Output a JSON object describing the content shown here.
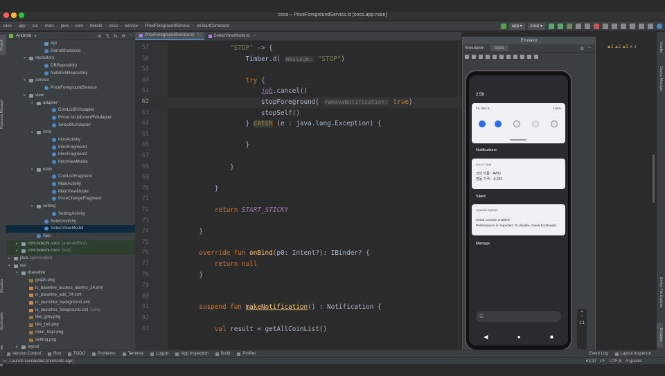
{
  "window": {
    "title": "coco – PriceForegroundService.kt [coco.app.main]"
  },
  "breadcrumbs": [
    "coco",
    "app",
    "src",
    "main",
    "java",
    "com",
    "bokchi",
    "coco",
    "service",
    "PriceForegroundService",
    "onStartCommand"
  ],
  "run_config": "app",
  "device": "coco",
  "project": {
    "view": "Android",
    "rows": [
      {
        "d": 5,
        "t": "f",
        "label": "Api"
      },
      {
        "d": 5,
        "t": "c",
        "label": "RetrofitInstance"
      },
      {
        "d": 3,
        "t": "d",
        "open": true,
        "label": "repository"
      },
      {
        "d": 5,
        "t": "c",
        "label": "DBRepository"
      },
      {
        "d": 5,
        "t": "c",
        "label": "NetWorkRepository"
      },
      {
        "d": 3,
        "t": "d",
        "open": true,
        "label": "service"
      },
      {
        "d": 5,
        "t": "c",
        "label": "PriceForegroundService"
      },
      {
        "d": 3,
        "t": "d",
        "open": true,
        "label": "view"
      },
      {
        "d": 4,
        "t": "d",
        "open": true,
        "label": "adapter"
      },
      {
        "d": 6,
        "t": "c",
        "label": "CoinListRVAdapter"
      },
      {
        "d": 6,
        "t": "c",
        "label": "PriceListUpDownRVAdapter"
      },
      {
        "d": 6,
        "t": "c",
        "label": "SelectRVAdapter"
      },
      {
        "d": 4,
        "t": "d",
        "open": true,
        "label": "intro"
      },
      {
        "d": 6,
        "t": "c",
        "label": "IntroActivity"
      },
      {
        "d": 6,
        "t": "c",
        "label": "IntroFragment1"
      },
      {
        "d": 6,
        "t": "c",
        "label": "IntroFragment2"
      },
      {
        "d": 6,
        "t": "c",
        "label": "IntroViewModel"
      },
      {
        "d": 4,
        "t": "d",
        "open": true,
        "label": "main"
      },
      {
        "d": 6,
        "t": "c",
        "label": "CoinListFragment"
      },
      {
        "d": 6,
        "t": "c",
        "label": "MainActivity"
      },
      {
        "d": 6,
        "t": "c",
        "label": "MainViewModel"
      },
      {
        "d": 6,
        "t": "c",
        "label": "PriceChangeFragment"
      },
      {
        "d": 4,
        "t": "d",
        "open": true,
        "label": "setting"
      },
      {
        "d": 6,
        "t": "c",
        "label": "SettingActivity"
      },
      {
        "d": 5,
        "t": "c",
        "label": "SelectActivity"
      },
      {
        "d": 5,
        "t": "c",
        "label": "SelectViewModel",
        "sel": true
      },
      {
        "d": 4,
        "t": "c",
        "label": "App"
      },
      {
        "d": 2,
        "t": "d",
        "closed": true,
        "label": "com.bokchi.coco",
        "suffix": "(androidTest)",
        "sel2": true
      },
      {
        "d": 2,
        "t": "d",
        "closed": true,
        "label": "com.bokchi.coco",
        "suffix": "(test)",
        "sel2": true
      },
      {
        "d": 1,
        "t": "d",
        "closed": true,
        "label": "java",
        "suffix": "(generated)"
      },
      {
        "d": 1,
        "t": "d",
        "open": true,
        "label": "res"
      },
      {
        "d": 2,
        "t": "d",
        "open": true,
        "label": "drawable"
      },
      {
        "d": 3,
        "t": "i",
        "label": "graph.png"
      },
      {
        "d": 3,
        "t": "x",
        "label": "ic_baseline_access_alarms_24.xml"
      },
      {
        "d": 3,
        "t": "x",
        "label": "ic_baseline_add_24.xml"
      },
      {
        "d": 3,
        "t": "x",
        "label": "ic_launcher_background.xml"
      },
      {
        "d": 3,
        "t": "x",
        "label": "ic_launcher_foreground.xml",
        "suffix": "(v24)"
      },
      {
        "d": 3,
        "t": "i",
        "label": "like_grey.png"
      },
      {
        "d": 3,
        "t": "i",
        "label": "like_red.png"
      },
      {
        "d": 3,
        "t": "i",
        "label": "main_logo.png"
      },
      {
        "d": 3,
        "t": "i",
        "label": "setting.png"
      },
      {
        "d": 2,
        "t": "d",
        "closed": true,
        "label": "layout"
      }
    ]
  },
  "tabs": [
    {
      "label": "PriceForegroundService.kt",
      "active": true
    },
    {
      "label": "SelectViewModel.kt",
      "active": false
    }
  ],
  "code_lines": [
    {
      "n": "57",
      "html": "            <span class='str'>\"STOP\"</span> -> {"
    },
    {
      "n": "58",
      "html": "                Timber.d( <span class='hint'>message:</span> <span class='str'>\"STOP\"</span>)"
    },
    {
      "n": "59",
      "html": ""
    },
    {
      "n": "60",
      "html": "                <span class='kw'>try</span> {"
    },
    {
      "n": "61",
      "html": "                    <span class='const under'>job</span>.cancel()"
    },
    {
      "n": "62",
      "html": "                    stopForeground( <span class='hint'>removeNotification:</span> <span class='kw'>true</span>)",
      "cur": true
    },
    {
      "n": "63",
      "html": "                    stopSelf()"
    },
    {
      "n": "64",
      "html": "                } <span class='kw hl'>catch</span> (e : java.lang.Exception) {"
    },
    {
      "n": "65",
      "html": ""
    },
    {
      "n": "66",
      "html": "                }"
    },
    {
      "n": "67",
      "html": ""
    },
    {
      "n": "68",
      "html": "            }"
    },
    {
      "n": "69",
      "html": ""
    },
    {
      "n": "70",
      "html": "        }"
    },
    {
      "n": "71",
      "html": ""
    },
    {
      "n": "72",
      "html": "        <span class='kw'>return</span> <span class='const'>START_STICKY</span>"
    },
    {
      "n": "73",
      "html": ""
    },
    {
      "n": "74",
      "html": "    }"
    },
    {
      "n": "75",
      "html": ""
    },
    {
      "n": "76",
      "html": "    <span class='kw'>override fun</span> <span class='fn'>onBind</span>(p0: Intent?): IBinder? {"
    },
    {
      "n": "77",
      "html": "        <span class='kw'>return null</span>"
    },
    {
      "n": "78",
      "html": "    }"
    },
    {
      "n": "79",
      "html": ""
    },
    {
      "n": "80",
      "html": ""
    },
    {
      "n": "81",
      "html": "    <span class='kw'>suspend fun</span> <span class='fn under'>makeNotification</span>() : Notification {"
    },
    {
      "n": "82",
      "html": ""
    },
    {
      "n": "83",
      "html": "        <span class='kw'>val</span> result = getAllCoinList()"
    }
  ],
  "emulator": {
    "title": "Emulator",
    "label": "Emulator:",
    "device": "coco",
    "time": "2:58",
    "date": "Fri, Dec 9",
    "battery": "100%",
    "notifications_header": "Notifications",
    "app_line": "coco • now",
    "coin_name": "코인 이름 : AWO",
    "price_change": "변동 가격 : -0.092",
    "silent_header": "Silent",
    "sys_app": "Android System",
    "serial_title": "Serial console enabled",
    "serial_body": "Performance is impacted. To disable, check bootloader.",
    "manage": "Manage",
    "zoom": "1:1"
  },
  "warnings": {
    "w1": "▲2",
    "w2": "▲2",
    "w3": "▲5"
  },
  "bottom_tools": [
    "Version Control",
    "Run",
    "TODO",
    "Problems",
    "Terminal",
    "Logcat",
    "App Inspection",
    "Build",
    "Profiler"
  ],
  "bottom_tools_right": [
    "Event Log",
    "Layout Inspector"
  ],
  "left_tools": [
    "Project",
    "Resource Manager",
    "Structure",
    "Bookmarks",
    "Build Variants"
  ],
  "right_tools": [
    "Gradle",
    "Device Manager",
    "Device File Explorer",
    "Emulator"
  ],
  "status": {
    "message": "Launch succeeded (moments ago)",
    "pos": "63:37",
    "lf": "LF",
    "enc": "UTF-8",
    "indent": "4 spaces"
  }
}
